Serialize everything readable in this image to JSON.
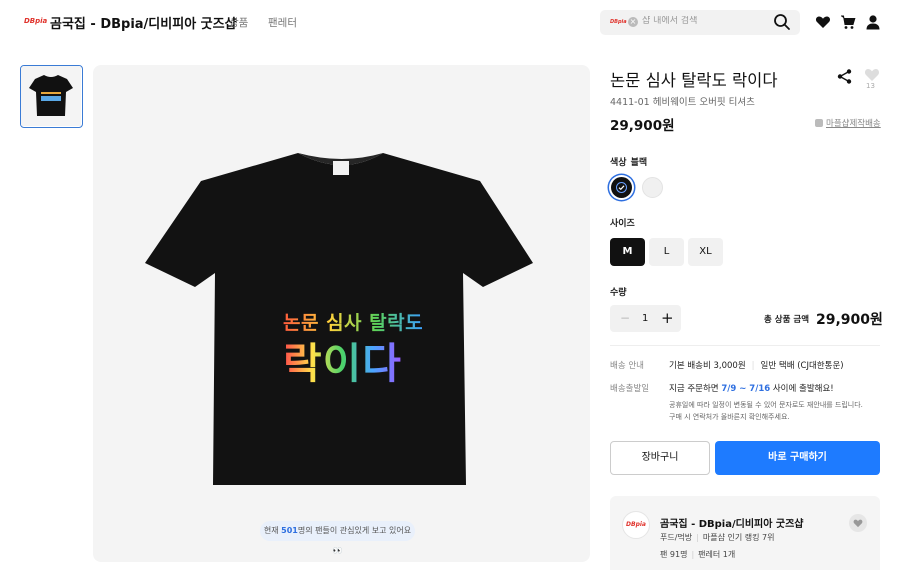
{
  "header": {
    "logo": "DBpia",
    "title": "곰국집 - DBpia/디비피아 굿즈샵",
    "nav": [
      "상품",
      "팬레터"
    ],
    "search_placeholder": "샵 내에서 검색"
  },
  "gallery": {
    "fans_notice_prefix": "현재",
    "fans_count": "501",
    "fans_notice_suffix": "명의 팬들이 관심있게 보고 있어요 👀",
    "shirt_text_line1": "논문 심사 탈락도",
    "shirt_text_line2": "락이다"
  },
  "product": {
    "title": "논문 심사 탈락도 락이다",
    "likes": "13",
    "subtitle": "4411-01 헤비웨이트 오버핏 티셔츠",
    "price": "29,900원",
    "made_link": "마플샵제작배송",
    "color_label": "색상",
    "color_value": "블랙",
    "colors": [
      {
        "name": "black",
        "hex": "#111111",
        "selected": true
      },
      {
        "name": "white",
        "hex": "#f0f0f0",
        "selected": false
      }
    ],
    "size_label": "사이즈",
    "sizes": [
      "M",
      "L",
      "XL"
    ],
    "selected_size": "M",
    "qty_label": "수량",
    "qty": "1",
    "total_label": "총 상품 금액",
    "total_price": "29,900원"
  },
  "shipping": {
    "info_label": "배송 안내",
    "info_value": "기본 배송비 3,000원",
    "info_method": "일반 택배 (CJ대한통운)",
    "date_label": "배송출발일",
    "date_prefix": "지금 주문하면",
    "date_range": "7/9 ~ 7/16",
    "date_suffix": "사이에 출발해요!",
    "note1": "공휴일에 따라 일정이 변동될 수 있어 문자로도 재안내를 드립니다.",
    "note2": "구매 시 연락처가 올바른지 확인해주세요."
  },
  "actions": {
    "cart": "장바구니",
    "buy": "바로 구매하기"
  },
  "shop": {
    "logo": "DBpia",
    "name": "곰국집 - DBpia/디비피아 굿즈샵",
    "category": "푸드/먹방",
    "rank": "마플샵 인기 랭킹 7위",
    "fans": "팬 91명",
    "letters": "팬레터 1개"
  },
  "colors": {
    "accent": "#1e7bff",
    "brand": "#e0322b"
  }
}
